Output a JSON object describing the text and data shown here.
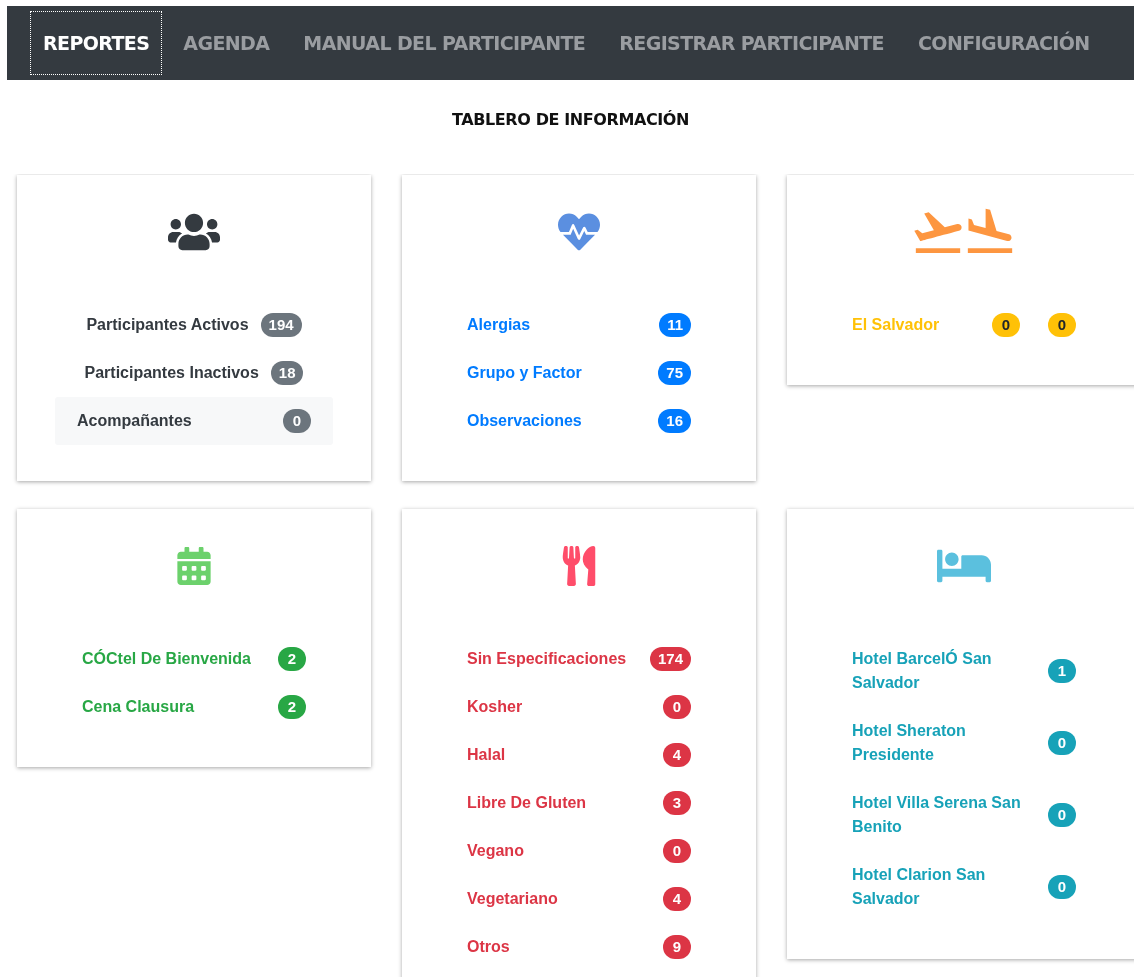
{
  "nav": [
    {
      "label": "REPORTES",
      "selected": true
    },
    {
      "label": "AGENDA",
      "selected": false
    },
    {
      "label": "MANUAL DEL PARTICIPANTE",
      "selected": false
    },
    {
      "label": "REGISTRAR PARTICIPANTE",
      "selected": false
    },
    {
      "label": "CONFIGURACIÓN",
      "selected": false
    }
  ],
  "title": "TABLERO DE INFORMACIÓN",
  "cards": [
    {
      "kind": "people",
      "color": "#6c757d",
      "rows": [
        {
          "label": "Participantes Activos",
          "counts": [
            "194"
          ],
          "selected": false
        },
        {
          "label": "Participantes Inactivos",
          "counts": [
            "18"
          ],
          "selected": false
        },
        {
          "label": "Acompañantes",
          "counts": [
            "0"
          ],
          "selected": true
        }
      ]
    },
    {
      "kind": "health",
      "color": "#007bff",
      "rows": [
        {
          "label": "Alergias",
          "counts": [
            "11"
          ],
          "selected": false
        },
        {
          "label": "Grupo y Factor",
          "counts": [
            "75"
          ],
          "selected": false
        },
        {
          "label": "Observaciones",
          "counts": [
            "16"
          ],
          "selected": false
        }
      ]
    },
    {
      "kind": "flights",
      "color": "#ffc107",
      "rows": [
        {
          "label": "El Salvador",
          "counts": [
            "0",
            "0"
          ],
          "selected": false
        }
      ]
    },
    {
      "kind": "events",
      "color": "#28a745",
      "rows": [
        {
          "label": "CÓCtel De Bienvenida",
          "counts": [
            "2"
          ],
          "selected": false
        },
        {
          "label": "Cena Clausura",
          "counts": [
            "2"
          ],
          "selected": false
        }
      ]
    },
    {
      "kind": "food",
      "color": "#dc3545",
      "rows": [
        {
          "label": "Sin Especificaciones",
          "counts": [
            "174"
          ],
          "selected": false
        },
        {
          "label": "Kosher",
          "counts": [
            "0"
          ],
          "selected": false
        },
        {
          "label": "Halal",
          "counts": [
            "4"
          ],
          "selected": false
        },
        {
          "label": "Libre De Gluten",
          "counts": [
            "3"
          ],
          "selected": false
        },
        {
          "label": "Vegano",
          "counts": [
            "0"
          ],
          "selected": false
        },
        {
          "label": "Vegetariano",
          "counts": [
            "4"
          ],
          "selected": false
        },
        {
          "label": "Otros",
          "counts": [
            "9"
          ],
          "selected": false
        }
      ]
    },
    {
      "kind": "hotels",
      "color": "#17a2b8",
      "rows": [
        {
          "label": "Hotel BarcelÓ San Salvador",
          "counts": [
            "1"
          ],
          "selected": false
        },
        {
          "label": "Hotel Sheraton Presidente",
          "counts": [
            "0"
          ],
          "selected": false
        },
        {
          "label": "Hotel Villa Serena San Benito",
          "counts": [
            "0"
          ],
          "selected": false
        },
        {
          "label": "Hotel Clarion San Salvador",
          "counts": [
            "0"
          ],
          "selected": false
        }
      ]
    }
  ]
}
